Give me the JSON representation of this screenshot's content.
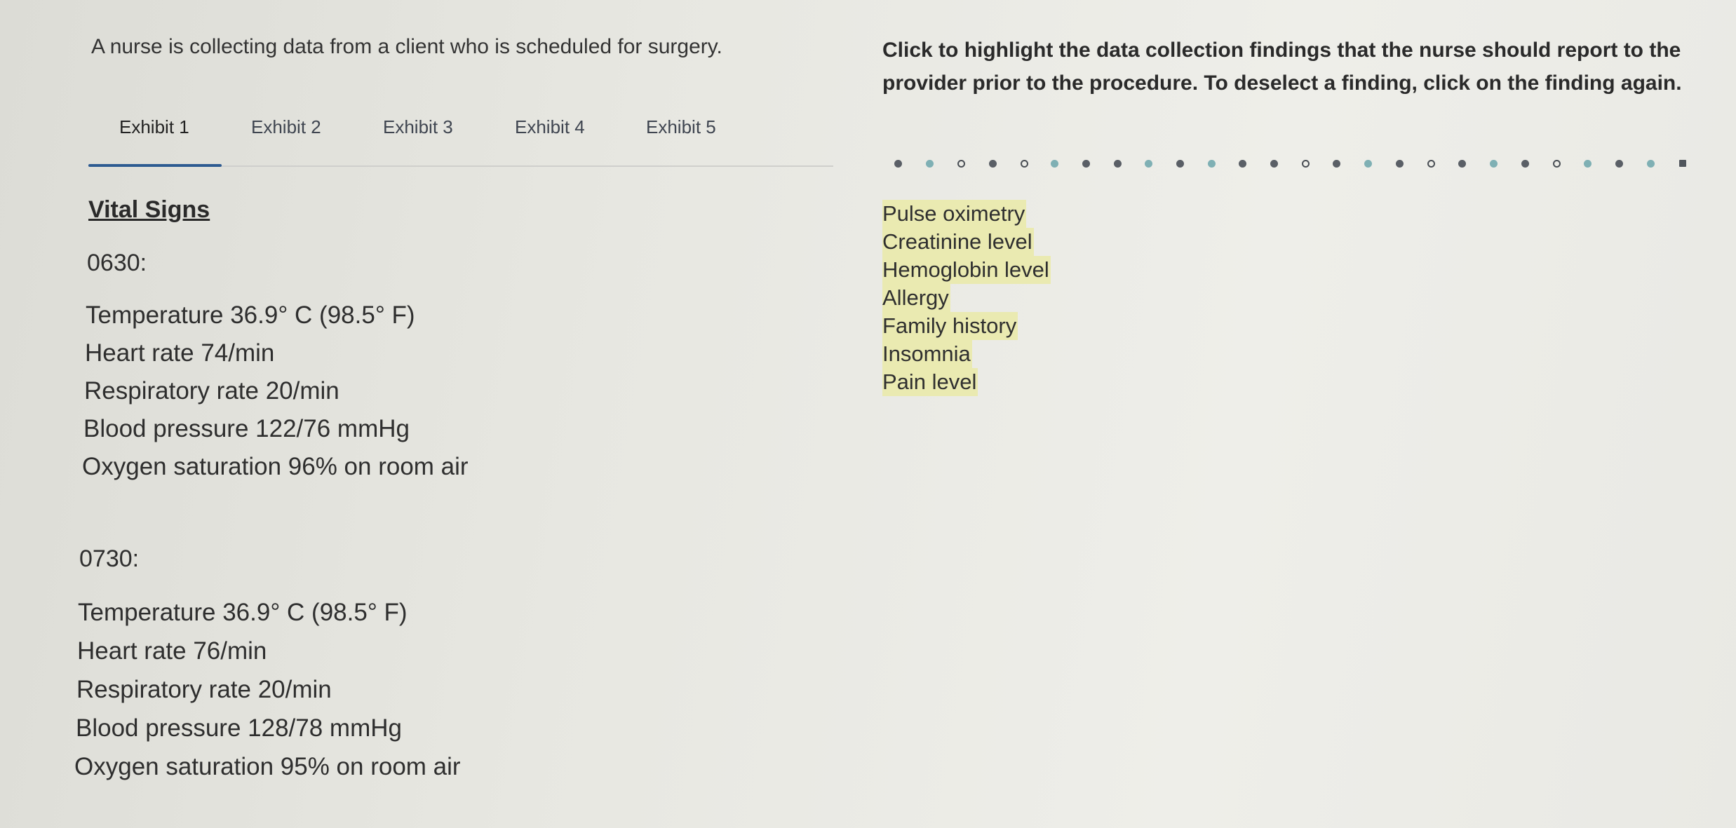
{
  "stem": "A nurse is collecting data from a client who is scheduled for surgery.",
  "tabs": [
    "Exhibit 1",
    "Exhibit 2",
    "Exhibit 3",
    "Exhibit 4",
    "Exhibit 5"
  ],
  "active_tab": "Exhibit 1",
  "exhibit": {
    "title": "Vital Signs",
    "readings": [
      {
        "time": "0630:",
        "vitals": [
          "Temperature 36.9° C (98.5° F)",
          "Heart rate 74/min",
          "Respiratory rate 20/min",
          "Blood pressure 122/76 mmHg",
          "Oxygen saturation 96% on room air"
        ]
      },
      {
        "time": "0730:",
        "vitals": [
          "Temperature 36.9° C (98.5° F)",
          "Heart rate 76/min",
          "Respiratory rate 20/min",
          "Blood pressure 128/78 mmHg",
          "Oxygen saturation 95% on room air"
        ]
      }
    ]
  },
  "instruction": "Click to highlight the data collection findings that the nurse should report to the provider prior to the procedure. To deselect a finding, click on the finding again.",
  "findings": [
    "Pulse oximetry",
    "Creatinine level",
    "Hemoglobin level",
    "Allergy",
    "Family history",
    "Insomnia",
    "Pain level"
  ],
  "colors": {
    "tab_underline": "#2d5b91",
    "finding_highlight": "#eaeab1"
  }
}
